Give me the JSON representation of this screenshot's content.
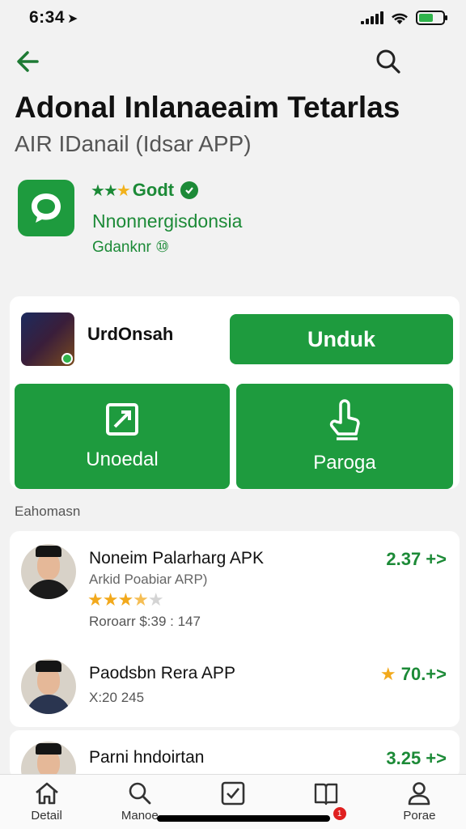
{
  "status_bar": {
    "time": "6:34",
    "battery_level": 0.6,
    "colors": {
      "battery": "#2fb34b"
    }
  },
  "header": {
    "title": "Adonal Inlanaeaim Tetarlas",
    "subtitle": "AIR IDanail (Idsar APP)"
  },
  "app": {
    "rating_label": "Godt",
    "stars_filled": 3,
    "developer": "Nnonnergisdonsia",
    "meta": "Gdanknr ⑩"
  },
  "actions": {
    "mini_label": "UrdOnsah",
    "primary_button": "Unduk",
    "tile_left": "Unoedal",
    "tile_right": "Paroga"
  },
  "section_label": "Eahomasn",
  "list": [
    {
      "title": "Noneim Palarharg APK",
      "subtitle": "Arkid Poabiar ARP)",
      "stars": 3.5,
      "meta": "Roroarr $:39 : 147",
      "value": "2.37 +>"
    },
    {
      "title": "Paodsbn Rera APP",
      "meta": "X:20 245",
      "value_star": "★",
      "value": "70.+>"
    },
    {
      "title": "Parni hndoirtan",
      "value": "3.25 +>"
    }
  ],
  "bottom_nav": [
    {
      "label": "Detail",
      "icon": "home-icon"
    },
    {
      "label": "Manoe",
      "icon": "search-icon"
    },
    {
      "label": "",
      "icon": "checkbox-icon"
    },
    {
      "label": "",
      "icon": "book-icon",
      "badge": "1"
    },
    {
      "label": "Porae",
      "icon": "profile-icon"
    }
  ],
  "colors": {
    "accent_green": "#1e9b3e",
    "text_green": "#1c8a37",
    "star_gold": "#f2a91c"
  }
}
